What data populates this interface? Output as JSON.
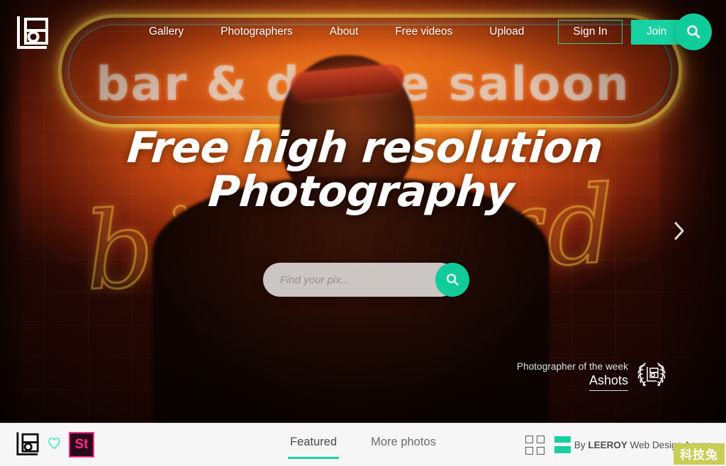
{
  "brand": {
    "logo_icon": "camera-logo-icon",
    "accent_color": "#17d1a0",
    "accent_color_dark": "#10cc9b"
  },
  "nav": {
    "links": [
      {
        "label": "Gallery",
        "name": "gallery"
      },
      {
        "label": "Photographers",
        "name": "photographers"
      },
      {
        "label": "About",
        "name": "about"
      },
      {
        "label": "Free videos",
        "name": "free-videos"
      },
      {
        "label": "Upload",
        "name": "upload"
      }
    ],
    "sign_in_label": "Sign In",
    "join_label": "Join",
    "search_icon": "search-icon"
  },
  "hero": {
    "headline_line1": "Free high resolution",
    "headline_line2": "Photography",
    "background_neon_text": "bar & dance saloon",
    "background_neon_script": "billboard",
    "next_arrow_icon": "chevron-right-icon",
    "search": {
      "placeholder": "Find your pix...",
      "value": "",
      "button_icon": "search-icon"
    },
    "photographer_of_week": {
      "label": "Photographer of the week",
      "name": "Ashots",
      "badge_icon": "laurel-wreath-badge-icon"
    }
  },
  "bottombar": {
    "logo_icon": "camera-logo-icon",
    "favorite_icon": "heart-icon",
    "stock_badge_label": "St",
    "tabs": [
      {
        "label": "Featured",
        "name": "featured",
        "active": true
      },
      {
        "label": "More photos",
        "name": "more-photos",
        "active": false
      }
    ],
    "grid_view_icon": "grid-view-icon",
    "credit_prefix": "By ",
    "credit_brand": "LEEROY",
    "credit_suffix": " Web Design Agency"
  },
  "watermark": {
    "text": "科技兔"
  }
}
